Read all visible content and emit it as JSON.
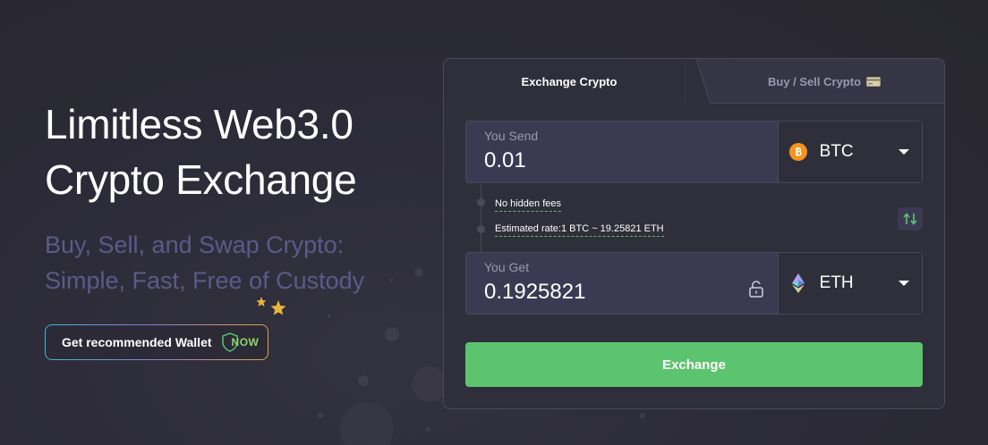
{
  "hero": {
    "title": "Limitless Web3.0 Crypto Exchange",
    "subtitle": "Buy, Sell, and Swap Crypto: Simple, Fast, Free of Custody",
    "wallet_button_label": "Get recommended Wallet",
    "wallet_badge": "NOW"
  },
  "tabs": [
    {
      "label": "Exchange Crypto",
      "active": true
    },
    {
      "label": "Buy / Sell Crypto",
      "active": false,
      "icon": "credit-card-icon"
    }
  ],
  "send": {
    "label": "You Send",
    "value": "0.01",
    "currency": "BTC",
    "currency_icon": "bitcoin-icon"
  },
  "info": {
    "fees": "No hidden fees",
    "rate": "Estimated rate:1 BTC ~ 19.25821 ETH"
  },
  "get": {
    "label": "You Get",
    "value": "0.1925821",
    "currency": "ETH",
    "currency_icon": "ethereum-icon"
  },
  "exchange_button": "Exchange",
  "colors": {
    "background": "#2b2a36",
    "card": "#2f2e3b",
    "input": "#3c3a53",
    "accent_green": "#5cc46f",
    "subtitle": "#5c5a8a",
    "bitcoin": "#f7931a"
  }
}
